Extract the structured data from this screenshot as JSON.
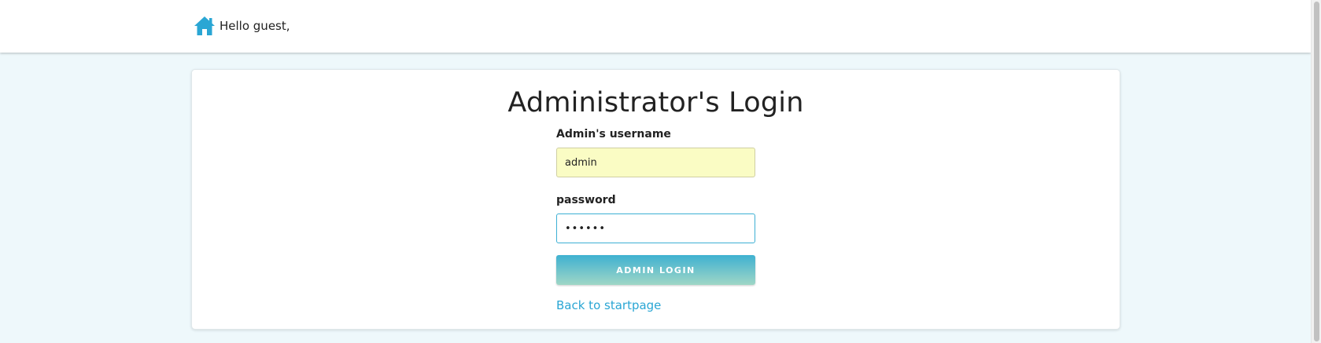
{
  "header": {
    "home_icon": "home-icon",
    "greeting": "Hello guest,"
  },
  "login": {
    "title": "Administrator's Login",
    "username_label": "Admin's username",
    "username_value": "admin",
    "password_label": "password",
    "password_value": "••••••",
    "submit_label": "ADMIN LOGIN",
    "back_link": "Back to startpage"
  },
  "colors": {
    "accent": "#2aa6d4",
    "page_background": "#eef8fb",
    "autofill_background": "#fafcc4",
    "button_gradient_top": "#3fb1d1",
    "button_gradient_bottom": "#9fd6c6"
  }
}
